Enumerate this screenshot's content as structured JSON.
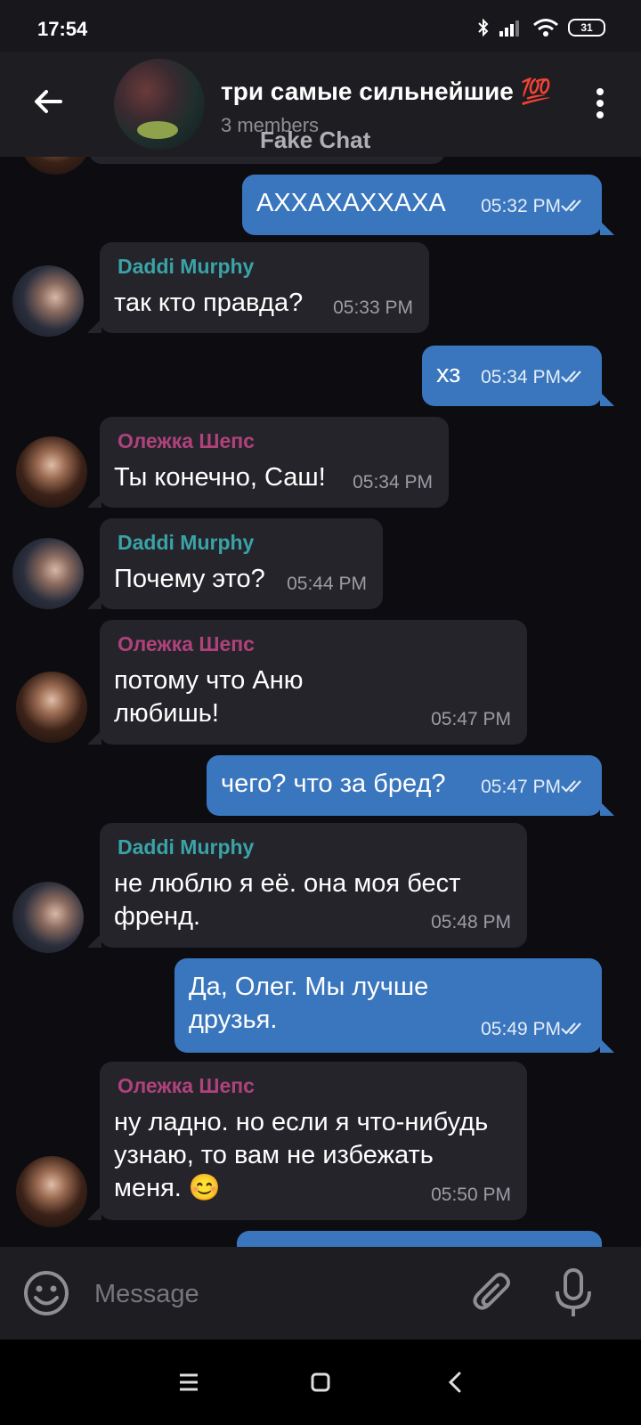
{
  "status_bar": {
    "time": "17:54",
    "battery": "31"
  },
  "header": {
    "title": "три самые сильнейшие 💯",
    "subtitle": "3 members",
    "watermark": "Fake Chat"
  },
  "messages": [
    {
      "direction": "out",
      "text": "АХХАХАХХАХА",
      "time": "05:32 PM"
    },
    {
      "direction": "in",
      "sender": "Daddi Murphy",
      "text": "так кто правда?",
      "time": "05:33 PM"
    },
    {
      "direction": "out",
      "text": "хз",
      "time": "05:34 PM"
    },
    {
      "direction": "in",
      "sender": "Олежка Шепс",
      "text": "Ты конечно, Саш!",
      "time": "05:34 PM"
    },
    {
      "direction": "in",
      "sender": "Daddi Murphy",
      "text": "Почему это?",
      "time": "05:44 PM"
    },
    {
      "direction": "in",
      "sender": "Олежка Шепс",
      "text_lines": [
        "потому что Аню",
        "любишь!"
      ],
      "time": "05:47 PM"
    },
    {
      "direction": "out",
      "text": "чего? что за бред?",
      "time": "05:47 PM"
    },
    {
      "direction": "in",
      "sender": "Daddi Murphy",
      "text_lines": [
        "не люблю я её. она моя бест",
        "френд."
      ],
      "time": "05:48 PM"
    },
    {
      "direction": "out",
      "text_lines": [
        "Да, Олег. Мы лучше",
        "друзья."
      ],
      "time": "05:49 PM"
    },
    {
      "direction": "in",
      "sender": "Олежка Шепс",
      "text_lines": [
        "ну ладно. но если я что-нибудь",
        "узнаю, то вам не избежать",
        "меня. 😊"
      ],
      "time": "05:50 PM"
    }
  ],
  "input": {
    "placeholder": "Message"
  },
  "colors": {
    "background": "#0d0c10",
    "header": "#1e1d22",
    "incoming_bubble": "#25242b",
    "outgoing_bubble": "#3a76be",
    "sender_daddi": "#3aa3a7",
    "sender_olezhka": "#b0427b"
  },
  "icons": [
    "back-arrow-icon",
    "more-vertical-icon",
    "emoji-icon",
    "attach-icon",
    "mic-icon",
    "double-check-icon",
    "menu-icon",
    "home-icon",
    "back-nav-icon"
  ]
}
